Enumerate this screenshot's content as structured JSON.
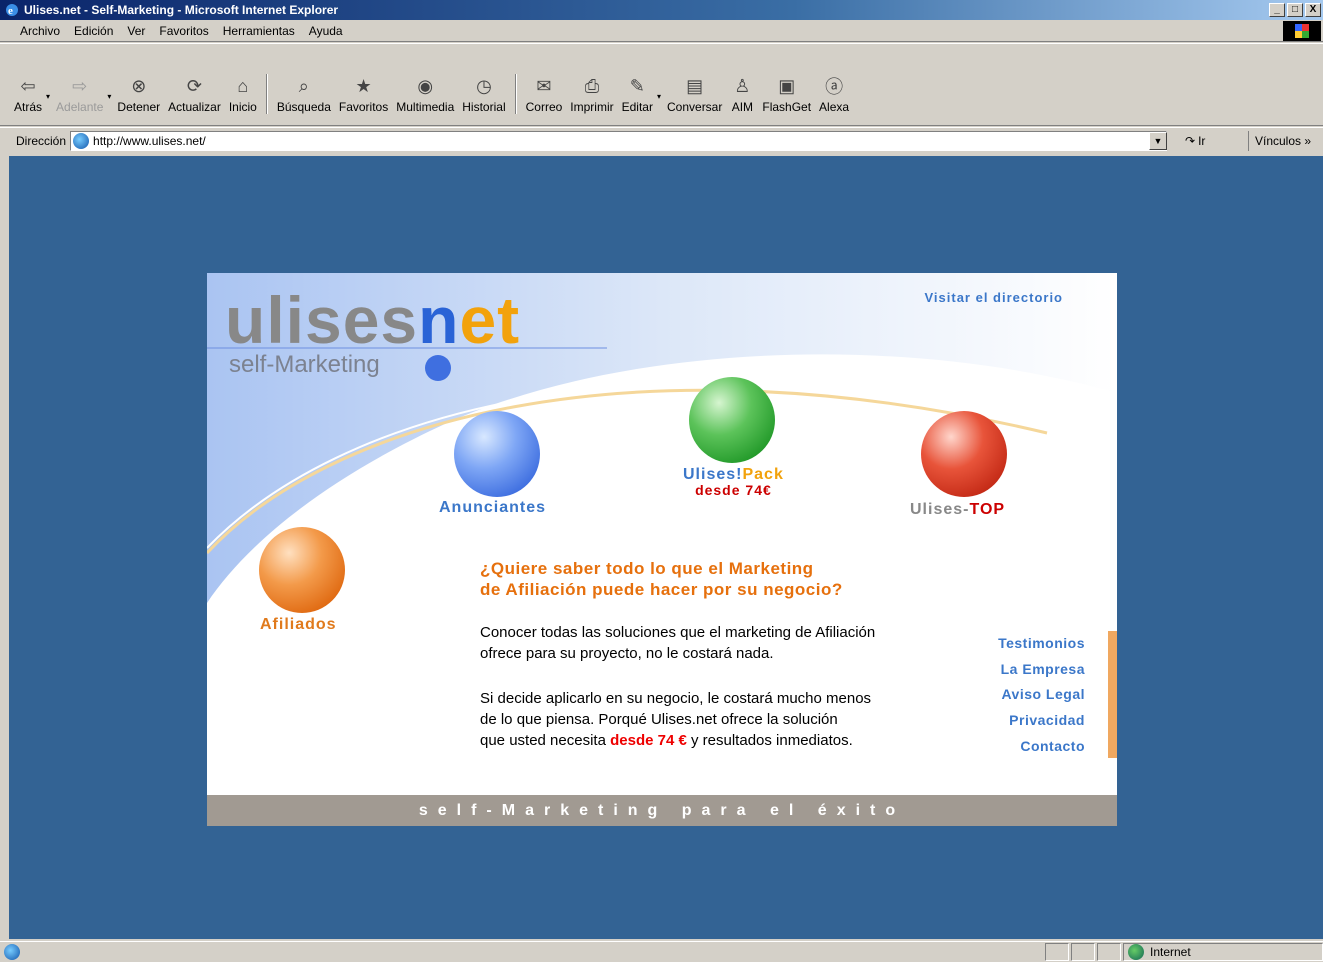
{
  "window": {
    "title": "Ulises.net - Self-Marketing - Microsoft Internet Explorer",
    "min_glyph": "_",
    "max_glyph": "□",
    "close_glyph": "X"
  },
  "menu": [
    "Archivo",
    "Edición",
    "Ver",
    "Favoritos",
    "Herramientas",
    "Ayuda"
  ],
  "toolbar": [
    {
      "label": "Atrás",
      "icon": "⇦",
      "name": "back",
      "dropdown": true
    },
    {
      "label": "Adelante",
      "icon": "⇨",
      "name": "forward",
      "disabled": true,
      "dropdown": true
    },
    {
      "label": "Detener",
      "icon": "⊗",
      "name": "stop"
    },
    {
      "label": "Actualizar",
      "icon": "⟳",
      "name": "refresh"
    },
    {
      "label": "Inicio",
      "icon": "⌂",
      "name": "home"
    },
    {
      "label": "Búsqueda",
      "icon": "⌕",
      "name": "search",
      "sep_before": true
    },
    {
      "label": "Favoritos",
      "icon": "★",
      "name": "favorites"
    },
    {
      "label": "Multimedia",
      "icon": "◉",
      "name": "media"
    },
    {
      "label": "Historial",
      "icon": "◷",
      "name": "history"
    },
    {
      "label": "Correo",
      "icon": "✉",
      "name": "mail",
      "sep_before": true
    },
    {
      "label": "Imprimir",
      "icon": "⎙",
      "name": "print"
    },
    {
      "label": "Editar",
      "icon": "✎",
      "name": "edit",
      "dropdown": true
    },
    {
      "label": "Conversar",
      "icon": "▤",
      "name": "discuss"
    },
    {
      "label": "AIM",
      "icon": "♙",
      "name": "aim"
    },
    {
      "label": "FlashGet",
      "icon": "▣",
      "name": "flashget"
    },
    {
      "label": "Alexa",
      "icon": "ⓐ",
      "name": "alexa"
    }
  ],
  "address": {
    "label": "Dirección",
    "url": "http://www.ulises.net/",
    "go": "Ir",
    "links": "Vínculos »"
  },
  "page": {
    "logo_ulises": "ulises",
    "logo_n": "n",
    "logo_et": "et",
    "logo_sub": "self-Marketing",
    "directory_link": "Visitar el directorio",
    "balls": {
      "anunciantes": "Anunciantes",
      "pack_a": "Ulises!",
      "pack_b": "Pack",
      "pack_price": "desde 74€",
      "top_a": "Ulises-",
      "top_b": "TOP",
      "afiliados": "Afiliados"
    },
    "headline_1": "¿Quiere saber todo lo que el Marketing",
    "headline_2": "de Afiliación puede hacer por su negocio?",
    "para1_l1": "Conocer todas las soluciones que el marketing de Afiliación",
    "para1_l2": "ofrece para su proyecto, no le costará nada.",
    "para2_l1": "Si decide aplicarlo en su negocio, le costará mucho menos",
    "para2_l2": "de lo que piensa. Porqué Ulises.net ofrece la solución",
    "para2_l3a": "que usted necesita",
    "para2_hl": "desde 74 €",
    "para2_l3b": "y resultados inmediatos.",
    "side_links": [
      "Testimonios",
      "La Empresa",
      "Aviso Legal",
      "Privacidad",
      "Contacto"
    ],
    "footer": "self-Marketing para el éxito"
  },
  "status": {
    "zone": "Internet"
  }
}
